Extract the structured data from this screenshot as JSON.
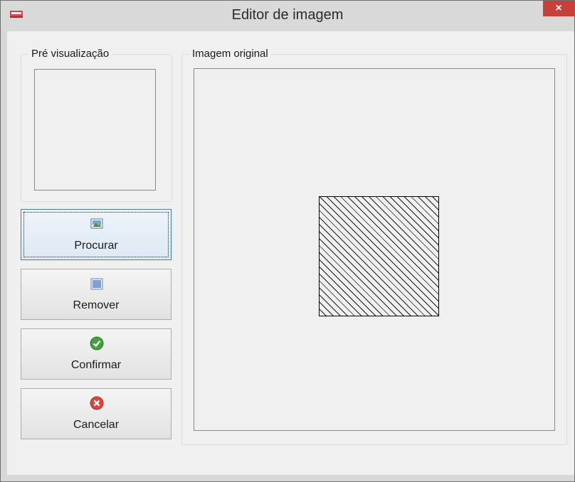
{
  "window": {
    "title": "Editor de imagem",
    "close_glyph": "×"
  },
  "preview_group": {
    "label": "Pré visualização"
  },
  "original_group": {
    "label": "Imagem original"
  },
  "buttons": [
    {
      "label": "Procurar",
      "icon": "image-icon"
    },
    {
      "label": "Remover",
      "icon": "remove-image-icon"
    },
    {
      "label": "Confirmar",
      "icon": "check-icon"
    },
    {
      "label": "Cancelar",
      "icon": "cancel-icon"
    }
  ],
  "colors": {
    "close_button": "#c7413a",
    "confirm_icon": "#3fa33a",
    "cancel_icon": "#d9463b",
    "focus_border": "#3c7fb1"
  }
}
